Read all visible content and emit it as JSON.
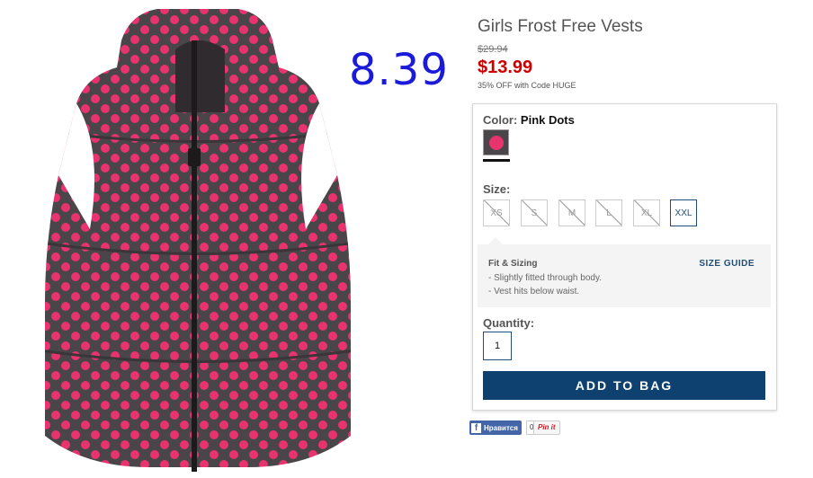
{
  "overlay_price": "8.39",
  "product": {
    "title": "Girls Frost Free Vests",
    "original_price": "$29.94",
    "sale_price": "$13.99",
    "promo": "35% OFF with Code HUGE",
    "image_icon": "pink-polka-dot-puffer-vest-image"
  },
  "color": {
    "label": "Color:",
    "value": "Pink Dots",
    "swatch_color": "#e8336e"
  },
  "size": {
    "label": "Size:",
    "options": [
      {
        "label": "XS",
        "available": false
      },
      {
        "label": "S",
        "available": false
      },
      {
        "label": "M",
        "available": false
      },
      {
        "label": "L",
        "available": false
      },
      {
        "label": "XL",
        "available": false
      },
      {
        "label": "XXL",
        "available": true
      }
    ]
  },
  "fit": {
    "title": "Fit & Sizing",
    "size_guide": "SIZE GUIDE",
    "lines": [
      "- Slightly fitted through body.",
      "- Vest hits below waist."
    ]
  },
  "quantity": {
    "label": "Quantity:",
    "value": "1"
  },
  "add_to_bag": "ADD TO BAG",
  "social": {
    "fb_like": "Нравится",
    "fb_count": "0",
    "pin_it": "Pin it"
  },
  "colors": {
    "accent": "#0e4170",
    "sale": "#cc0000",
    "overlay": "#1a1adb",
    "vest_body": "#4a4548",
    "dot": "#e8336e"
  }
}
